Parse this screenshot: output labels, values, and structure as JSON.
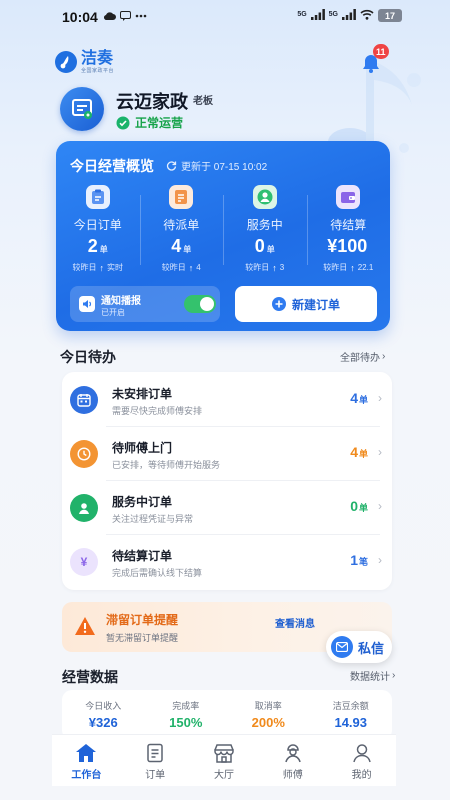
{
  "status_bar": {
    "time": "10:04",
    "battery": "17",
    "net_1": "5G",
    "net_2": "5G"
  },
  "header": {
    "logo_name": "洁奏",
    "logo_sub": "全国家政平台",
    "notification_count": "11",
    "shop_name": "云迈家政",
    "shop_role": "老板",
    "shop_status": "正常运营"
  },
  "overview": {
    "title": "今日经营概览",
    "updated": "更新于 07-15 10:02",
    "stats": [
      {
        "label": "今日订单",
        "value": "2",
        "unit": "单",
        "compare_label": "较昨日",
        "compare_value": "实时",
        "icon": "clipboard-icon",
        "color": "#5a93f2"
      },
      {
        "label": "待派单",
        "value": "4",
        "unit": "单",
        "compare_label": "较昨日",
        "compare_value": "4",
        "icon": "document-icon",
        "color": "#f2934a"
      },
      {
        "label": "服务中",
        "value": "0",
        "unit": "单",
        "compare_label": "较昨日",
        "compare_value": "3",
        "icon": "worker-icon",
        "color": "#2fbf72"
      },
      {
        "label": "待结算",
        "value": "¥100",
        "unit": "",
        "compare_label": "较昨日",
        "compare_value": "22.1",
        "icon": "wallet-icon",
        "color": "#8b65e8"
      }
    ],
    "notify_title": "通知播报",
    "notify_sub": "已开启",
    "notify_on": true,
    "new_order_label": "新建订单"
  },
  "todo": {
    "title": "今日待办",
    "link": "全部待办",
    "items": [
      {
        "title": "未安排订单",
        "desc": "需要尽快完成师傅安排",
        "count": "4",
        "unit": "单",
        "icon": "calendar-icon",
        "color": "#2f6fe0",
        "count_color": "#2f6fe0"
      },
      {
        "title": "待师傅上门",
        "desc": "已安排，等待师傅开始服务",
        "count": "4",
        "unit": "单",
        "icon": "clock-icon",
        "color": "#f39433",
        "count_color": "#f08a1c"
      },
      {
        "title": "服务中订单",
        "desc": "关注过程凭证与异常",
        "count": "0",
        "unit": "单",
        "icon": "worker-icon",
        "color": "#21b26a",
        "count_color": "#21b26a"
      },
      {
        "title": "待结算订单",
        "desc": "完成后需确认线下结算",
        "count": "1",
        "unit": "笔",
        "icon": "yen-icon",
        "color": "#8b65e8",
        "count_color": "#2f6fe0"
      }
    ]
  },
  "alert": {
    "title": "滞留订单提醒",
    "sub": "暂无滞留订单提醒",
    "link": "查看消息",
    "dm_label": "私信"
  },
  "business": {
    "title": "经营数据",
    "link": "数据统计",
    "items": [
      {
        "label": "今日收入",
        "value": "¥326",
        "color": "#1f63d8"
      },
      {
        "label": "完成率",
        "value": "150%",
        "color": "#21b26a"
      },
      {
        "label": "取消率",
        "value": "200%",
        "color": "#f08a1c"
      },
      {
        "label": "洁豆余额",
        "value": "14.93",
        "color": "#1f63d8"
      }
    ]
  },
  "tabbar": {
    "items": [
      {
        "label": "工作台",
        "icon": "home-icon",
        "active": true
      },
      {
        "label": "订单",
        "icon": "order-icon",
        "active": false
      },
      {
        "label": "大厅",
        "icon": "shop-icon",
        "active": false
      },
      {
        "label": "师傅",
        "icon": "worker-icon",
        "active": false
      },
      {
        "label": "我的",
        "icon": "user-icon",
        "active": false
      }
    ]
  }
}
